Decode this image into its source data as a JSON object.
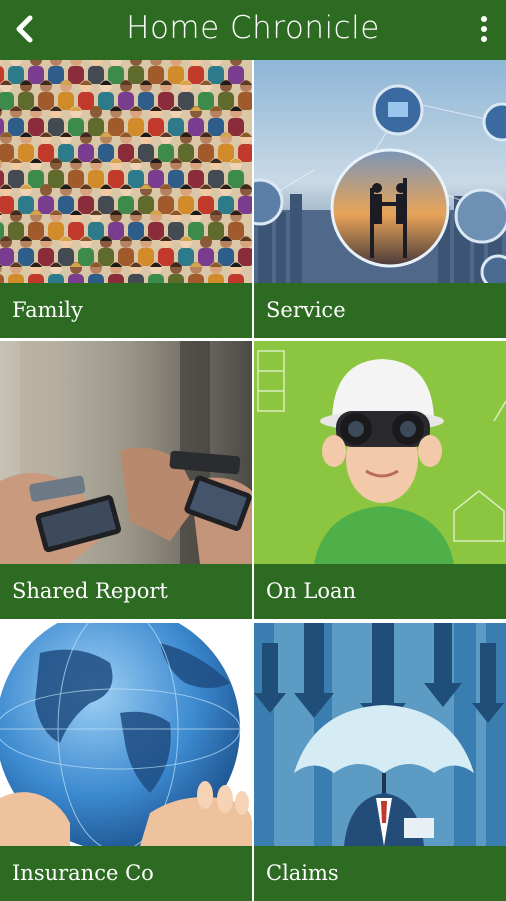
{
  "appbar": {
    "title": "Home Chronicle",
    "back_icon": "back-arrow-icon",
    "menu_icon": "overflow-menu-icon"
  },
  "tiles": [
    {
      "label": "Family",
      "image": "crowd-of-people-image"
    },
    {
      "label": "Service",
      "image": "business-handshake-network-image"
    },
    {
      "label": "Shared Report",
      "image": "hands-holding-phones-image"
    },
    {
      "label": "On Loan",
      "image": "boy-with-binoculars-image"
    },
    {
      "label": "Insurance Co",
      "image": "hands-holding-globe-image"
    },
    {
      "label": "Claims",
      "image": "umbrella-protection-image"
    }
  ],
  "colors": {
    "brand_green": "#2e6b22",
    "text": "#ffffff"
  }
}
